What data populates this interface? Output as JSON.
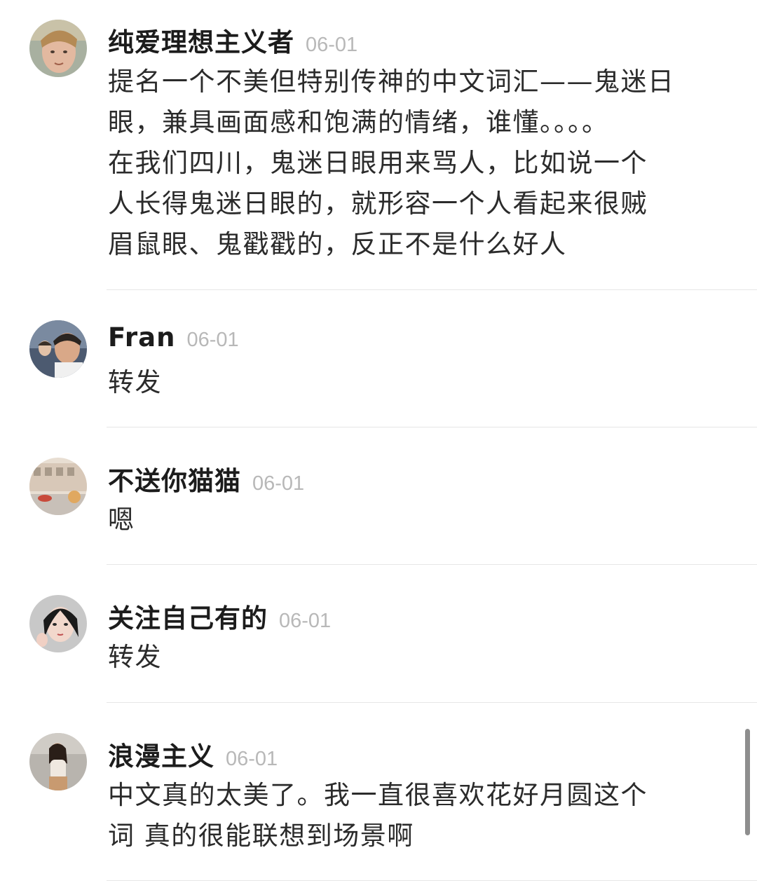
{
  "comments": [
    {
      "username": "纯爱理想主义者",
      "time": "06-01",
      "lines": [
        "提名一个不美但特别传神的中文词汇——鬼迷日",
        "眼，兼具画面感和饱满的情绪，谁懂。。。。",
        "在我们四川，鬼迷日眼用来骂人，比如说一个",
        "人长得鬼迷日眼的，就形容一个人看起来很贼",
        "眉鼠眼、鬼戳戳的，反正不是什么好人"
      ]
    },
    {
      "username": "Fran",
      "time": "06-01",
      "lines": [
        "转发"
      ]
    },
    {
      "username": "不送你猫猫",
      "time": "06-01",
      "lines": [
        "嗯"
      ]
    },
    {
      "username": "关注自己有的",
      "time": "06-01",
      "lines": [
        "转发"
      ]
    },
    {
      "username": "浪漫主义",
      "time": "06-01",
      "lines": [
        "中文真的太美了。我一直很喜欢花好月圆这个",
        "词 真的很能联想到场景啊"
      ]
    }
  ]
}
